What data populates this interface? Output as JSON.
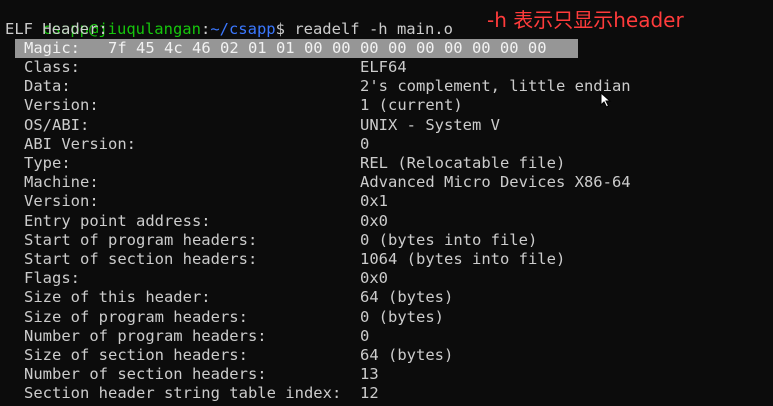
{
  "prompt": {
    "user_host": "csapp@jiuqulangan",
    "colon": ":",
    "path": "~/csapp",
    "symbol": "$ ",
    "command": "readelf -h main.o"
  },
  "header_title": "ELF Header:",
  "magic": {
    "label": "Magic:",
    "bytes": "7f 45 4c 46 02 01 01 00 00 00 00 00 00 00 00 00"
  },
  "fields": [
    {
      "label": "Class:",
      "value": "ELF64"
    },
    {
      "label": "Data:",
      "value": "2's complement, little endian"
    },
    {
      "label": "Version:",
      "value": "1 (current)"
    },
    {
      "label": "OS/ABI:",
      "value": "UNIX - System V"
    },
    {
      "label": "ABI Version:",
      "value": "0"
    },
    {
      "label": "Type:",
      "value": "REL (Relocatable file)"
    },
    {
      "label": "Machine:",
      "value": "Advanced Micro Devices X86-64"
    },
    {
      "label": "Version:",
      "value": "0x1"
    },
    {
      "label": "Entry point address:",
      "value": "0x0"
    },
    {
      "label": "Start of program headers:",
      "value": "0 (bytes into file)"
    },
    {
      "label": "Start of section headers:",
      "value": "1064 (bytes into file)"
    },
    {
      "label": "Flags:",
      "value": "0x0"
    },
    {
      "label": "Size of this header:",
      "value": "64 (bytes)"
    },
    {
      "label": "Size of program headers:",
      "value": "0 (bytes)"
    },
    {
      "label": "Number of program headers:",
      "value": "0"
    },
    {
      "label": "Size of section headers:",
      "value": "64 (bytes)"
    },
    {
      "label": "Number of section headers:",
      "value": "13"
    },
    {
      "label": "Section header string table index:",
      "value": "12"
    }
  ],
  "annotation": "-h 表示只显示header",
  "colors": {
    "background": "#0c0c0c",
    "text": "#cccccc",
    "prompt_user": "#16c60c",
    "prompt_path": "#3b78ff",
    "annotation": "#ff3b3b"
  }
}
